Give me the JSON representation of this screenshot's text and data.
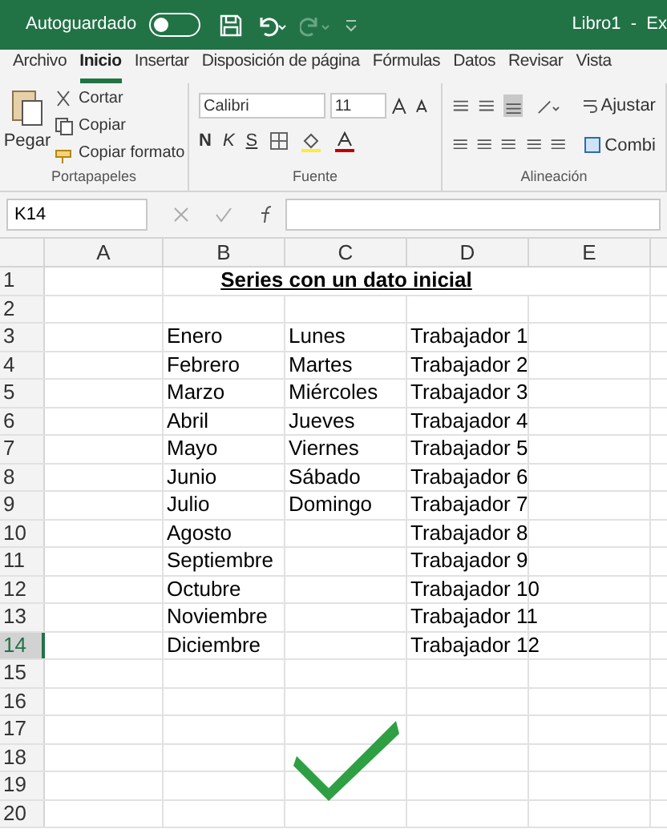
{
  "title_bar": {
    "autosave_label": "Autoguardado",
    "autosave_on": false,
    "document_title": "Libro1  -  Ex"
  },
  "tabs": [
    {
      "label": "Archivo",
      "selected": false
    },
    {
      "label": "Inicio",
      "selected": true
    },
    {
      "label": "Insertar",
      "selected": false
    },
    {
      "label": "Disposición de página",
      "selected": false
    },
    {
      "label": "Fórmulas",
      "selected": false
    },
    {
      "label": "Datos",
      "selected": false
    },
    {
      "label": "Revisar",
      "selected": false
    },
    {
      "label": "Vista",
      "selected": false
    }
  ],
  "ribbon": {
    "clipboard": {
      "paste": "Pegar",
      "cut": "Cortar",
      "copy": "Copiar",
      "format_painter": "Copiar formato",
      "label": "Portapapeles"
    },
    "font": {
      "name": "Calibri",
      "size": "11",
      "bold": "N",
      "italic": "K",
      "underline": "S",
      "label": "Fuente"
    },
    "alignment": {
      "wrap": "Ajustar",
      "merge": "Combi",
      "label": "Alineación"
    }
  },
  "name_box": "K14",
  "columns": [
    "A",
    "B",
    "C",
    "D",
    "E"
  ],
  "rows": [
    {
      "number": "1",
      "selected": false,
      "heading": "Series con un dato inicial"
    },
    {
      "number": "2",
      "selected": false
    },
    {
      "number": "3",
      "selected": false,
      "cells": {
        "B": "Enero",
        "C": "Lunes",
        "D": "Trabajador 1"
      }
    },
    {
      "number": "4",
      "selected": false,
      "cells": {
        "B": "Febrero",
        "C": "Martes",
        "D": "Trabajador 2"
      }
    },
    {
      "number": "5",
      "selected": false,
      "cells": {
        "B": "Marzo",
        "C": "Miércoles",
        "D": "Trabajador 3"
      }
    },
    {
      "number": "6",
      "selected": false,
      "cells": {
        "B": "Abril",
        "C": "Jueves",
        "D": "Trabajador 4"
      }
    },
    {
      "number": "7",
      "selected": false,
      "cells": {
        "B": "Mayo",
        "C": "Viernes",
        "D": "Trabajador 5"
      }
    },
    {
      "number": "8",
      "selected": false,
      "cells": {
        "B": "Junio",
        "C": "Sábado",
        "D": "Trabajador 6"
      }
    },
    {
      "number": "9",
      "selected": false,
      "cells": {
        "B": "Julio",
        "C": "Domingo",
        "D": "Trabajador 7"
      }
    },
    {
      "number": "10",
      "selected": false,
      "cells": {
        "B": "Agosto",
        "D": "Trabajador 8"
      }
    },
    {
      "number": "11",
      "selected": false,
      "cells": {
        "B": "Septiembre",
        "D": "Trabajador 9"
      }
    },
    {
      "number": "12",
      "selected": false,
      "cells": {
        "B": "Octubre",
        "D": "Trabajador 10"
      }
    },
    {
      "number": "13",
      "selected": false,
      "cells": {
        "B": "Noviembre",
        "D": "Trabajador 11"
      }
    },
    {
      "number": "14",
      "selected": true,
      "cells": {
        "B": "Diciembre",
        "D": "Trabajador 12"
      }
    },
    {
      "number": "15",
      "selected": false
    },
    {
      "number": "16",
      "selected": false
    },
    {
      "number": "17",
      "selected": false
    },
    {
      "number": "18",
      "selected": false
    },
    {
      "number": "19",
      "selected": false
    },
    {
      "number": "20",
      "selected": false
    }
  ]
}
